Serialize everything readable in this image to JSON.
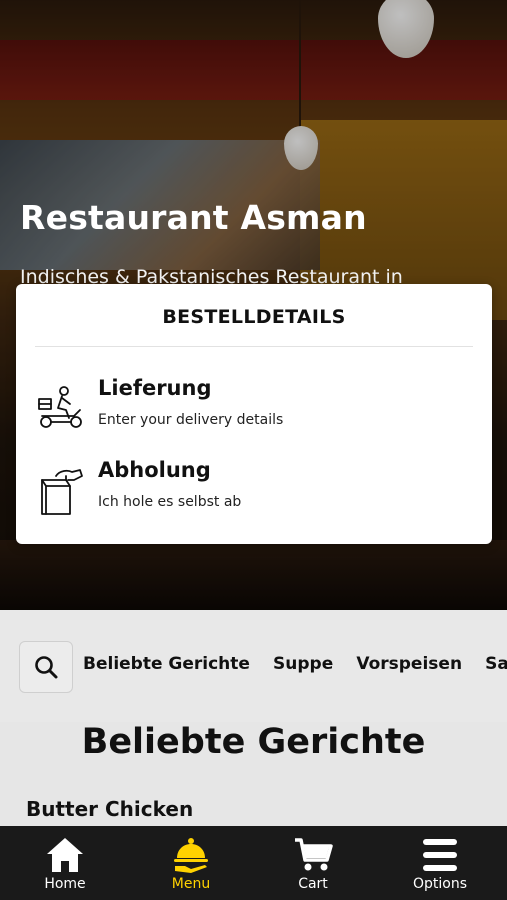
{
  "hero": {
    "title": "Restaurant Asman",
    "subtitle": "Indisches & Pakstanisches Restaurant in"
  },
  "modal": {
    "title": "BESTELLDETAILS",
    "options": [
      {
        "label": "Lieferung",
        "description": "Enter your delivery details",
        "icon": "delivery-scooter-icon"
      },
      {
        "label": "Abholung",
        "description": "Ich hole es selbst ab",
        "icon": "pickup-bag-icon"
      }
    ]
  },
  "categories": {
    "search_icon": "search-icon",
    "items": [
      "Beliebte Gerichte",
      "Suppe",
      "Vorspeisen",
      "Sa"
    ]
  },
  "section": {
    "title": "Beliebte Gerichte",
    "first_item": "Butter Chicken"
  },
  "bottom_nav": {
    "items": [
      {
        "label": "Home",
        "icon": "home-icon"
      },
      {
        "label": "Menu",
        "icon": "menu-cloche-icon",
        "active": true
      },
      {
        "label": "Cart",
        "icon": "cart-icon"
      },
      {
        "label": "Options",
        "icon": "hamburger-icon"
      }
    ]
  },
  "colors": {
    "accent": "#ffd200",
    "nav_background": "#1a1a1a",
    "page_background": "#e8e8e8"
  }
}
